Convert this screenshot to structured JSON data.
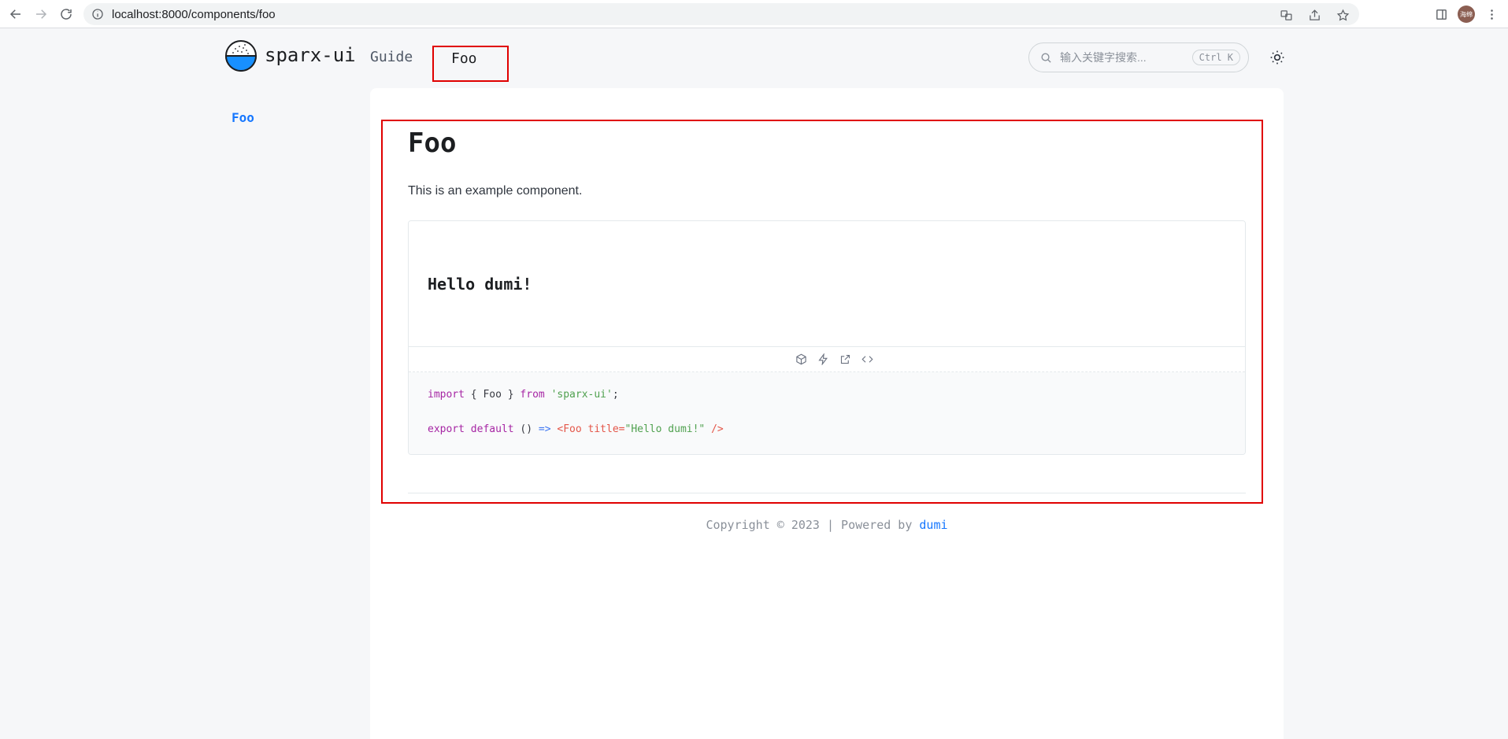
{
  "browser": {
    "url": "localhost:8000/components/foo",
    "avatar_text": "海绵"
  },
  "header": {
    "brand": "sparx-ui",
    "nav": [
      {
        "label": "Guide"
      },
      {
        "label": "Foo"
      }
    ],
    "search_placeholder": "输入关键字搜索...",
    "search_shortcut": "Ctrl K"
  },
  "sidebar": {
    "items": [
      {
        "label": "Foo"
      }
    ]
  },
  "main": {
    "title": "Foo",
    "description": "This is an example component.",
    "demo": {
      "preview_heading": "Hello dumi!",
      "code": {
        "line1": {
          "kw1": "import",
          "p1": "{ Foo }",
          "kw2": "from",
          "str": "'sparx-ui'",
          "end": ";"
        },
        "line2": {
          "kw1": "export",
          "kw2": "default",
          "p1": "()",
          "arrow": "=>",
          "tag_open": "<Foo",
          "attr": "title=",
          "str": "\"Hello dumi!\"",
          "tag_close": "/>"
        }
      }
    }
  },
  "footer": {
    "text": "Copyright © 2023 | Powered by",
    "link": "dumi"
  },
  "colors": {
    "accent": "#1677ff",
    "highlight_box": "#e00000"
  }
}
